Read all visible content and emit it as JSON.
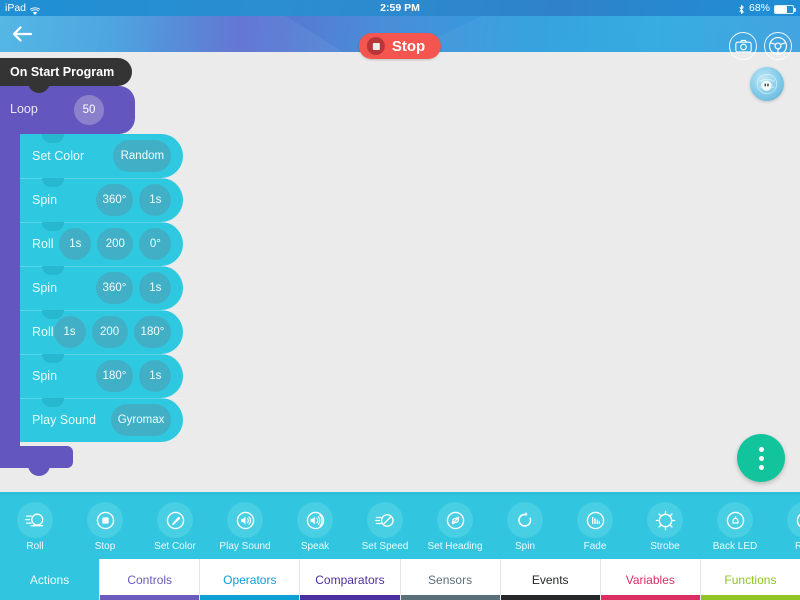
{
  "status_bar": {
    "carrier": "iPad",
    "wifi_icon": "wifi-icon",
    "time": "2:59 PM",
    "bluetooth_icon": "bluetooth-icon",
    "battery_percent": "68%",
    "battery_icon": "battery-icon"
  },
  "navbar": {
    "back_icon": "back-arrow-icon",
    "stop_label": "Stop",
    "stop_icon": "stop-square-icon",
    "camera_icon": "camera-icon",
    "drive_icon": "drive-wheel-icon",
    "stop_color": "#f4564f"
  },
  "canvas": {
    "hat_block": {
      "label": "On Start Program",
      "color": "#343434"
    },
    "loop_block": {
      "label": "Loop",
      "value": "50",
      "color": "#6357bf"
    },
    "robot_badge": {
      "icon": "sphero-robot-icon"
    },
    "fab": {
      "icon": "more-vertical-icon",
      "color": "#11c49b"
    },
    "blocks": [
      {
        "name": "Set Color",
        "params": [
          {
            "text": "Random",
            "style": "wide"
          }
        ]
      },
      {
        "name": "Spin",
        "params": [
          {
            "text": "360°",
            "style": "pad"
          },
          {
            "text": "1s",
            "style": ""
          }
        ]
      },
      {
        "name": "Roll",
        "params": [
          {
            "text": "1s",
            "style": ""
          },
          {
            "text": "200",
            "style": "pad"
          },
          {
            "text": "0°",
            "style": ""
          }
        ]
      },
      {
        "name": "Spin",
        "params": [
          {
            "text": "360°",
            "style": "pad"
          },
          {
            "text": "1s",
            "style": ""
          }
        ]
      },
      {
        "name": "Roll",
        "params": [
          {
            "text": "1s",
            "style": ""
          },
          {
            "text": "200",
            "style": "pad"
          },
          {
            "text": "180°",
            "style": "pad"
          }
        ]
      },
      {
        "name": "Spin",
        "params": [
          {
            "text": "180°",
            "style": "pad"
          },
          {
            "text": "1s",
            "style": ""
          }
        ]
      },
      {
        "name": "Play Sound",
        "params": [
          {
            "text": "Gyromax",
            "style": "wide"
          }
        ]
      }
    ]
  },
  "palette": {
    "items": [
      {
        "label": "Roll",
        "icon": "roll-icon"
      },
      {
        "label": "Stop",
        "icon": "stop-icon"
      },
      {
        "label": "Set Color",
        "icon": "set-color-icon"
      },
      {
        "label": "Play Sound",
        "icon": "play-sound-icon"
      },
      {
        "label": "Speak",
        "icon": "speak-icon"
      },
      {
        "label": "Set Speed",
        "icon": "set-speed-icon"
      },
      {
        "label": "Set Heading",
        "icon": "set-heading-icon"
      },
      {
        "label": "Spin",
        "icon": "spin-icon"
      },
      {
        "label": "Fade",
        "icon": "fade-icon"
      },
      {
        "label": "Strobe",
        "icon": "strobe-icon"
      },
      {
        "label": "Back LED",
        "icon": "back-led-icon"
      },
      {
        "label": "Raw",
        "icon": "raw-motor-icon"
      }
    ]
  },
  "tabs": [
    {
      "label": "Actions",
      "color": "#31c5e0",
      "active": true
    },
    {
      "label": "Controls",
      "color": "#6a5bbd",
      "active": false
    },
    {
      "label": "Operators",
      "color": "#0c9fd4",
      "active": false
    },
    {
      "label": "Comparators",
      "color": "#4b2f9e",
      "active": false
    },
    {
      "label": "Sensors",
      "color": "#5a7079",
      "active": false
    },
    {
      "label": "Events",
      "color": "#26282a",
      "active": false
    },
    {
      "label": "Variables",
      "color": "#d92f62",
      "active": false
    },
    {
      "label": "Functions",
      "color": "#8fc422",
      "active": false
    }
  ]
}
